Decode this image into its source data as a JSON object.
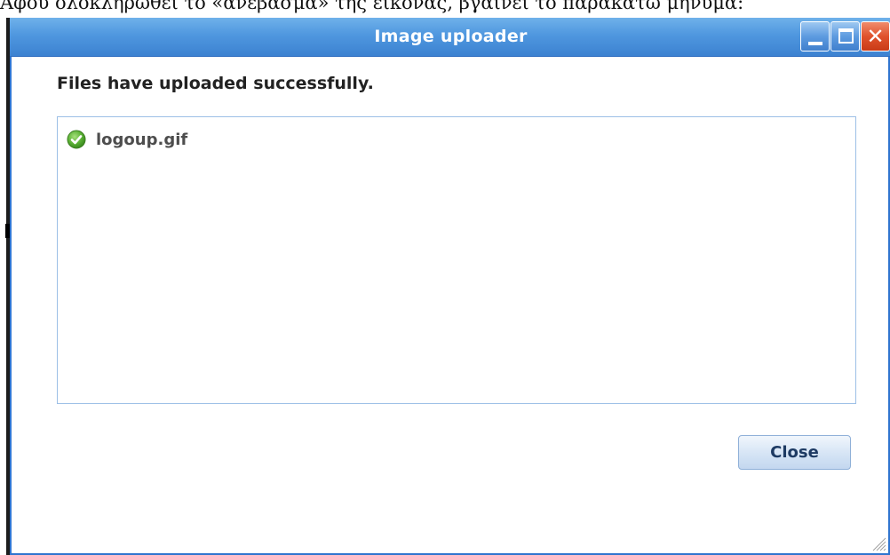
{
  "background": {
    "caption": "Αφού ολοκληρωθεί το «ανέβασμα» της εικόνας, βγαίνει το παρακάτω μήνυμα:"
  },
  "window": {
    "title": "Image uploader",
    "controls": {
      "minimize": "minimize-icon",
      "maximize": "maximize-icon",
      "close_glyph": "✕"
    }
  },
  "dialog": {
    "message": "Files have uploaded successfully.",
    "files": [
      {
        "name": "logoup.gif",
        "status": "success",
        "icon": "check-circle-icon"
      }
    ],
    "close_label": "Close"
  },
  "colors": {
    "titlebar": "#4f97df",
    "window_border": "#2f74cf",
    "success_green": "#5bb135",
    "close_red": "#e0522c"
  }
}
